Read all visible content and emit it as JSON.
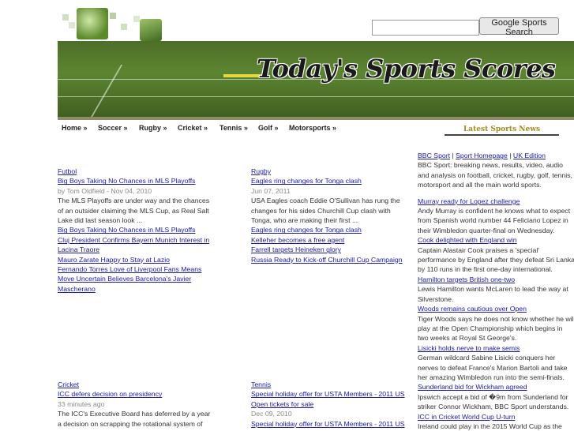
{
  "header": {
    "search_placeholder": "",
    "search_button": "Google Sports Search",
    "banner_title": "Today's Sports Scores"
  },
  "nav": {
    "items": [
      "Home »",
      "Soccer »",
      "Rugby »",
      "Cricket »",
      "Tennis »",
      "Golf »",
      "Motorsports »"
    ],
    "latest_label": "Latest Sports News"
  },
  "futbol": {
    "category": "Futbol",
    "headline": "Big Boys Taking No Chances in MLS Playoffs",
    "meta": "by Tom Oldfield - Nov 04, 2010",
    "body": [
      "The MLS Playoffs are under way and the chances",
      "of an outsider claiming the MLS Cup, as Real Salt",
      "Lake did last season look ..."
    ],
    "links": [
      "Big Boys Taking No Chances in MLS Playoffs",
      "Cluj President Confirms Bayern Munich Interest in",
      "Lacina Traore",
      "Mauro Zarate Happy to Stay at Lazio",
      "Fernando Torres Love of Liverpool Fans Means",
      "Move Uncertain Believes Barcelona's Javier",
      "Mascherano"
    ]
  },
  "rugby": {
    "category": "Rugby",
    "headline": "Eagles ring changes for Tonga clash",
    "meta": "Jun 07, 2011",
    "body": [
      "USA Eagles coach Eddie O'Sullivan has rung the",
      "changes for his sides Churchill Cup clash with",
      "Tonga, who are making their first ..."
    ],
    "links": [
      "Eagles ring changes for Tonga clash",
      "Kelleher becomes a free agent",
      "Farrell targets Heineken glory",
      "Russia Ready to Kick-off Churchill Cup Campaign"
    ]
  },
  "cricket": {
    "category": "Cricket",
    "headline": "ICC defers decision on presidency",
    "meta": "33 minutes ago",
    "body": [
      "The ICC's Executive Board has deferred by a year",
      "a decision on scrapping the rotational system of"
    ]
  },
  "tennis": {
    "category": "Tennis",
    "headline": "Special holiday offer for USTA Members - 2011 US",
    "headline2": "Open tickets for sale",
    "meta": "Dec 09, 2010",
    "links": [
      "Special holiday offer for USTA Members - 2011 US"
    ]
  },
  "bbc": {
    "source_links": [
      "BBC Sport",
      "Sport Homepage",
      "UK Edition"
    ],
    "source_sep": " | ",
    "intro": [
      "BBC Sport: breaking news, results, video, audio",
      "and analysis on football, cricket, rugby, golf, tennis,",
      "motorsport and all the main world sports."
    ],
    "items": [
      {
        "title": "Murray ready for Lopez challenge",
        "body": [
          "Andy Murray is confident he knows what to expect",
          "from Spanish world number 44 Feliciano Lopez in",
          "their Wimbledon quarter-final on Wednesday."
        ]
      },
      {
        "title": "Cook delighted with England win",
        "body": [
          "Captain Alastair Cook praises a 'special'",
          "performance by England after they defeat Sri Lanka",
          "by 110 runs in the first one-day international."
        ]
      },
      {
        "title": "Hamilton targets British one-two",
        "body": [
          "Lewis Hamilton wants McLaren to lead the way at",
          "Silverstone."
        ]
      },
      {
        "title": "Woods remains cautious over Open",
        "body": [
          "Tiger Woods says he does not know whether he will",
          "play at the Open Championship which begins in",
          "two weeks at Royal St George's."
        ]
      },
      {
        "title": "Lisicki holds nerve to make semis",
        "body": [
          "German wildcard Sabine Lisicki conquers her",
          "nerves to defeat France's Marion Bartoli and take",
          "her amazing Wimbledon run into the semi-finals."
        ]
      },
      {
        "title": "Sunderland bid for Wickham agreed",
        "body": [
          "Ipswich accept a bid of �9m from Sunderland for",
          "striker Connor Wickham, BBC Sport understands."
        ]
      },
      {
        "title": "ICC in Cricket World Cup U-turn",
        "body": [
          "Ireland could play in the 2015 World Cup as the"
        ]
      }
    ]
  }
}
